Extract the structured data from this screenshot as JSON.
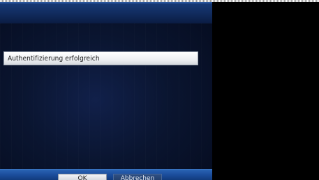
{
  "dialog": {
    "message": "Authentifizierung erfolgreich"
  },
  "buttons": {
    "ok_label": "OK",
    "cancel_label": "Abbrechen"
  },
  "colors": {
    "panel_background": "#0a1530",
    "top_bar": "#183b78",
    "bottom_bar": "#1b4d9c",
    "message_row": "#ffffff",
    "button_ok": "#e8eaee",
    "button_cancel": "#2a4675"
  }
}
